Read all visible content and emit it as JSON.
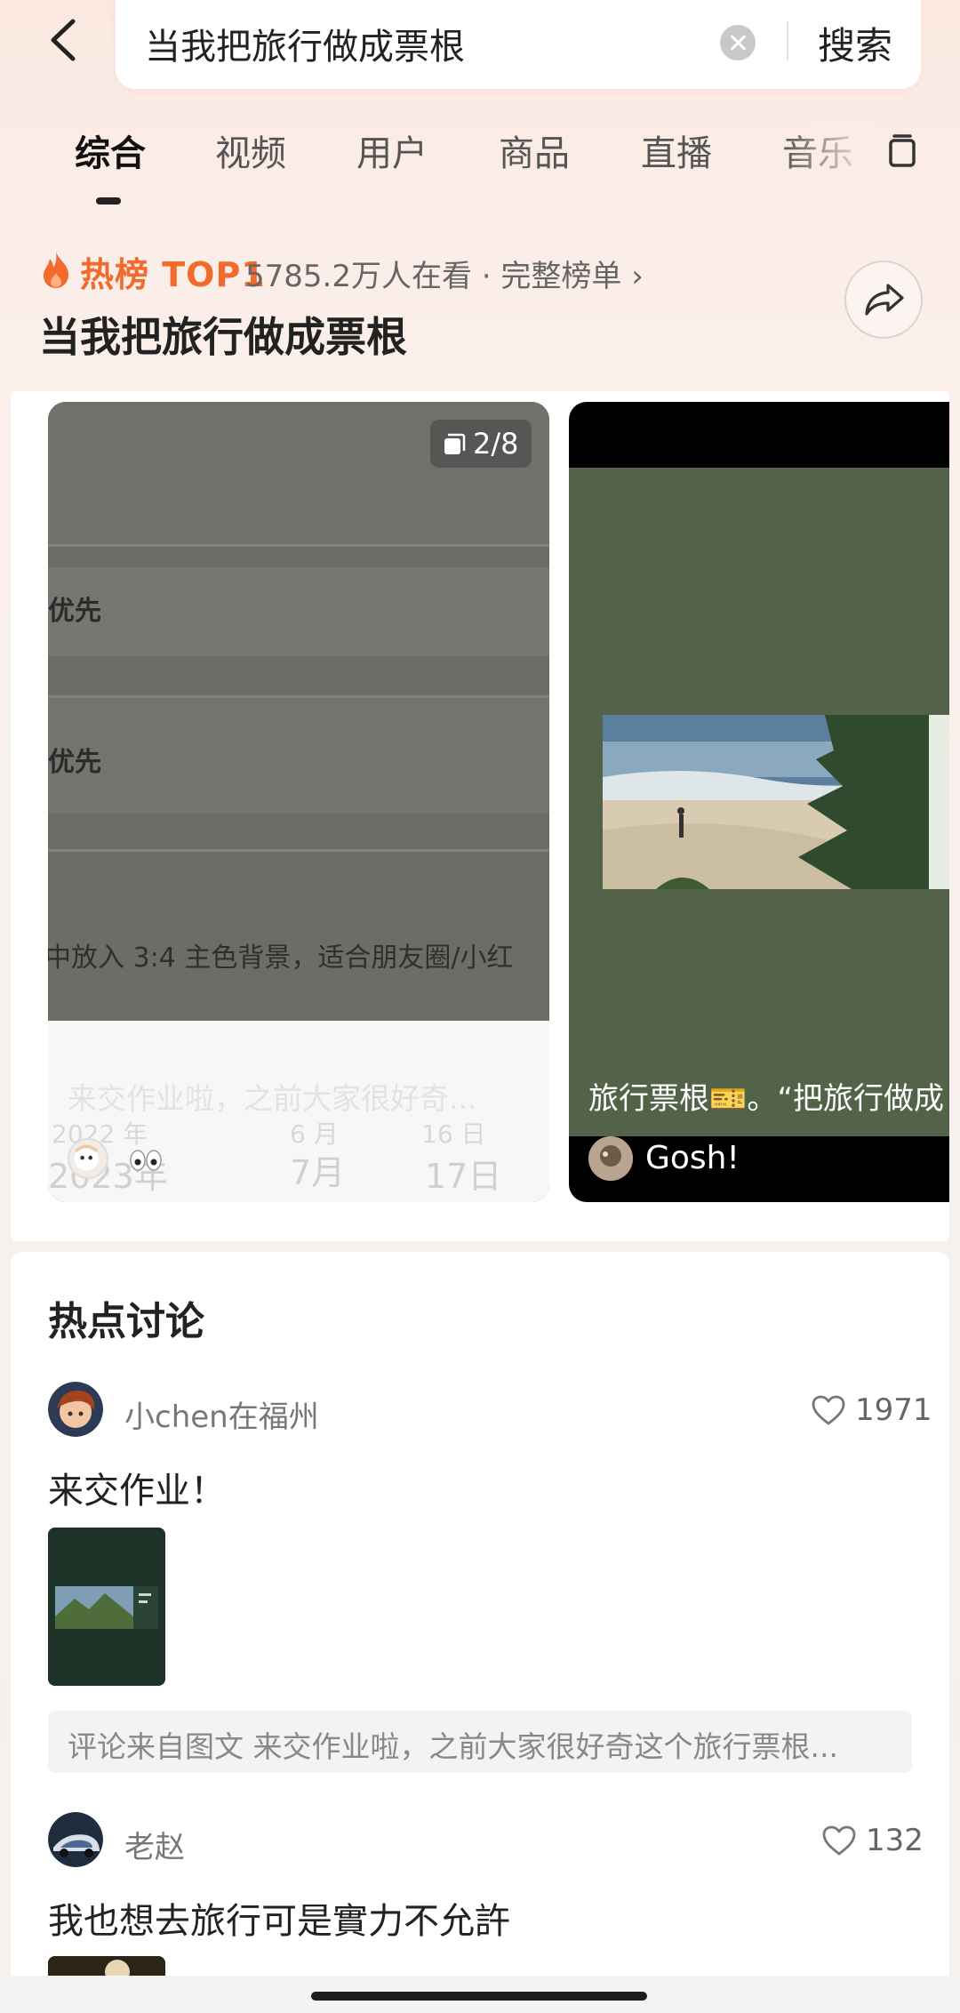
{
  "search": {
    "query": "当我把旅行做成票根",
    "button_label": "搜索"
  },
  "tabs": [
    {
      "label": "综合",
      "active": true
    },
    {
      "label": "视频"
    },
    {
      "label": "用户"
    },
    {
      "label": "商品"
    },
    {
      "label": "直播"
    },
    {
      "label": "音乐"
    }
  ],
  "hot_rank": {
    "label": "热榜 TOP1",
    "meta": "5785.2万人在看 · 完整榜单 ›",
    "title": "当我把旅行做成票根"
  },
  "card1": {
    "page_indicator": "2/8",
    "text_row1": "优先",
    "text_row2": "优先",
    "text_row3": "中放入 3:4 主色背景，适合朋友圈/小红",
    "caption": "来交作业啦，之前大家很好奇...",
    "date_year_top": "2022 年",
    "date_month_top": "6 月",
    "date_day_top": "16 日",
    "date_year": "2023年",
    "date_month": "7月",
    "date_day": "17日"
  },
  "card2": {
    "caption": "旅行票根🎫。“把旅行做成",
    "author": "Gosh!"
  },
  "discussion": {
    "title": "热点讨论",
    "posts": [
      {
        "user": "小chen在福州",
        "likes": "1971",
        "text": "来交作业！",
        "source": "评论来自图文 来交作业啦，之前大家很好奇这个旅行票根..."
      },
      {
        "user": "老赵",
        "likes": "132",
        "text": "我也想去旅行可是實力不允許"
      }
    ]
  },
  "colors": {
    "hot_orange": "#f26a2c",
    "card_green": "#536349",
    "card_gray": "#6b6d67"
  }
}
